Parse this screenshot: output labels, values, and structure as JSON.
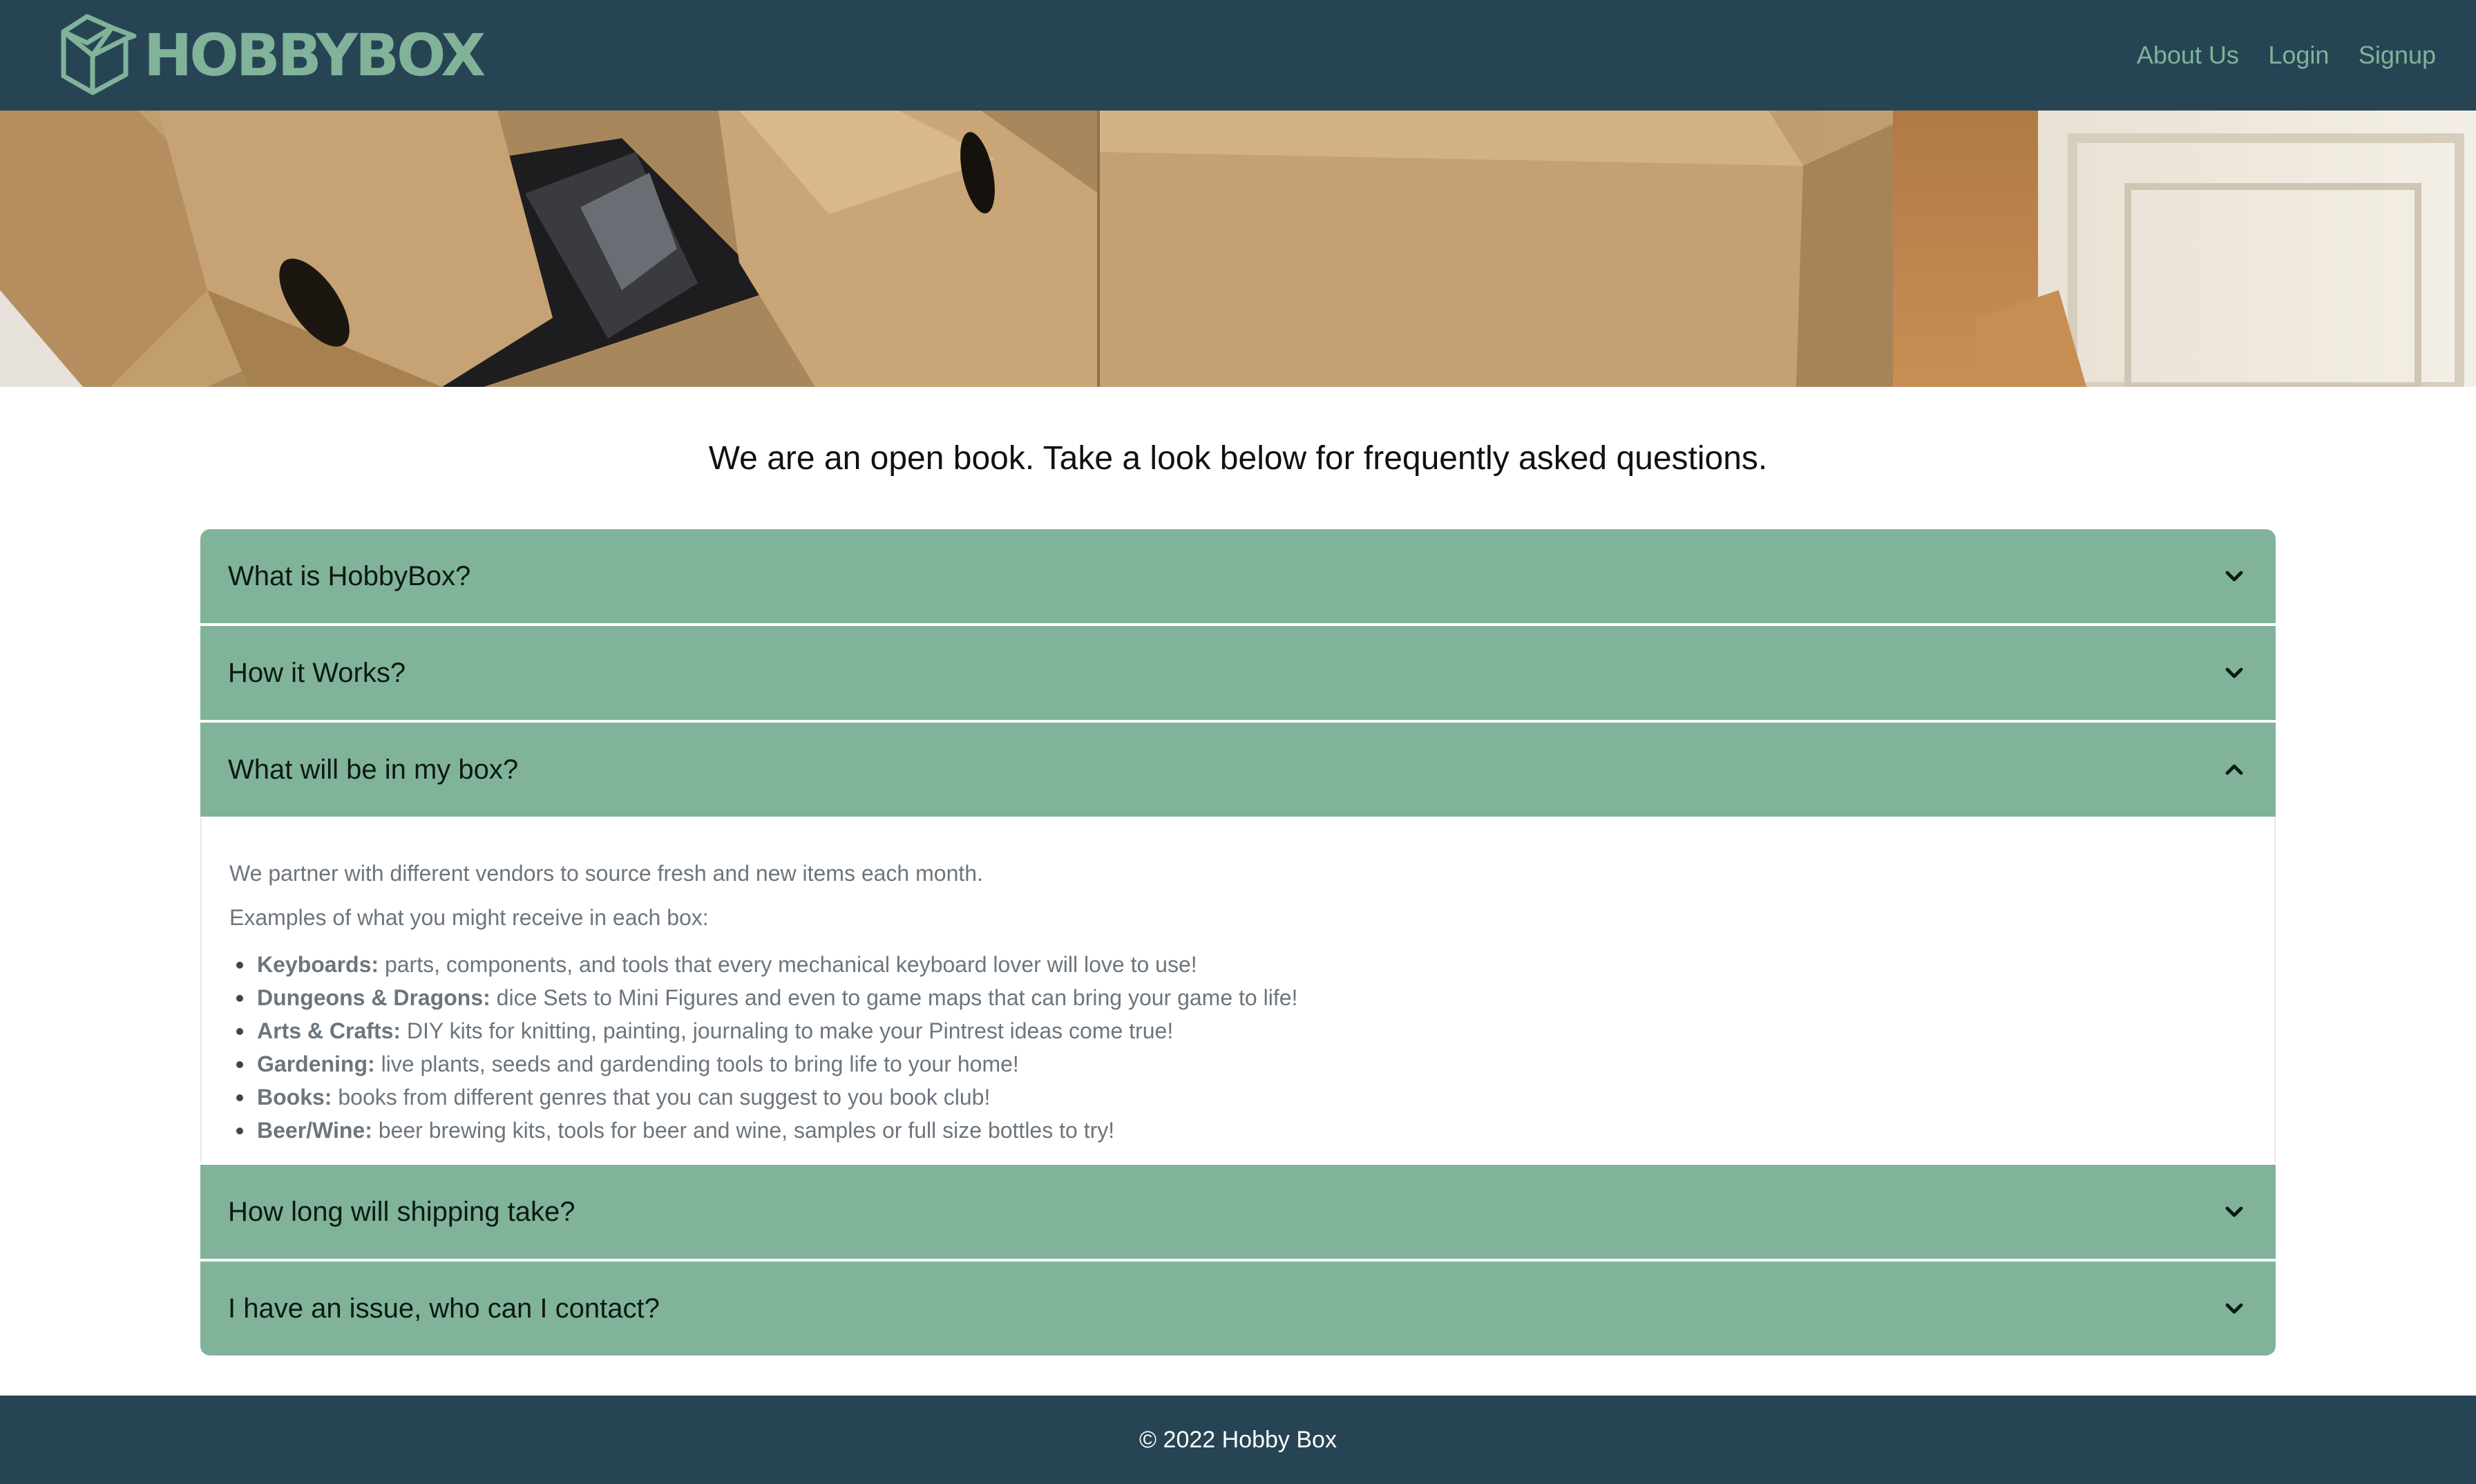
{
  "brand": {
    "name": "HOBBYBOX",
    "logo_icon": "open-box-icon"
  },
  "nav": {
    "links": [
      {
        "label": "About Us"
      },
      {
        "label": "Login"
      },
      {
        "label": "Signup"
      }
    ]
  },
  "hero": {
    "image": "cardboard-boxes-photo"
  },
  "intro": {
    "text": "We are an open book. Take a look below for frequently asked questions."
  },
  "faq": {
    "items": [
      {
        "question": "What is HobbyBox?",
        "expanded": false
      },
      {
        "question": "How it Works?",
        "expanded": false
      },
      {
        "question": "What will be in my box?",
        "expanded": true
      },
      {
        "question": "How long will shipping take?",
        "expanded": false
      },
      {
        "question": "I have an issue, who can I contact?",
        "expanded": false
      }
    ],
    "open_answer": {
      "intro": "We partner with different vendors to source fresh and new items each month.",
      "examples_label": "Examples of what you might receive in each box:",
      "list": [
        {
          "term": "Keyboards:",
          "text": " parts, components, and tools that every mechanical keyboard lover will love to use!"
        },
        {
          "term": "Dungeons & Dragons:",
          "text": " dice Sets to Mini Figures and even to game maps that can bring your game to life!"
        },
        {
          "term": "Arts & Crafts:",
          "text": " DIY kits for knitting, painting, journaling to make your Pintrest ideas come true!"
        },
        {
          "term": "Gardening:",
          "text": " live plants, seeds and gardending tools to bring life to your home!"
        },
        {
          "term": "Books:",
          "text": " books from different genres that you can suggest to you book club!"
        },
        {
          "term": "Beer/Wine:",
          "text": " beer brewing kits, tools for beer and wine, samples or full size bottles to try!"
        }
      ]
    }
  },
  "footer": {
    "text": "© 2022 Hobby Box"
  },
  "colors": {
    "navbar_bg": "#274454",
    "accent": "#80b39a",
    "body_text": "#6c757d"
  }
}
